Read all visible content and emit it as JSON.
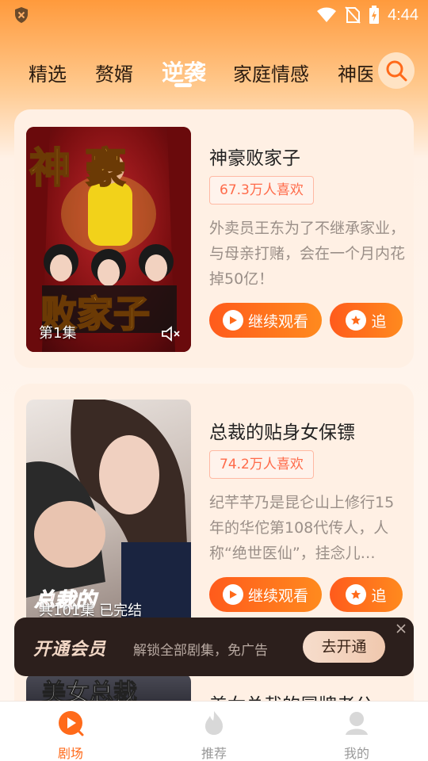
{
  "status_bar": {
    "time": "4:44"
  },
  "tabs": {
    "items": [
      {
        "label": "精选"
      },
      {
        "label": "赘婿"
      },
      {
        "label": "逆袭"
      },
      {
        "label": "家庭情感"
      },
      {
        "label": "神医"
      }
    ],
    "active": "逆袭"
  },
  "cards": [
    {
      "title": "神豪败家子",
      "likes": "67.3万人喜欢",
      "description": "外卖员王东为了不继承家业，与母亲打赌，会在一个月内花掉50亿！",
      "poster_caption": "第1集",
      "poster_text_top": "神 豪",
      "poster_text_bottom": "败家子",
      "watch_label": "继续观看",
      "follow_label": "追"
    },
    {
      "title": "总裁的贴身女保镖",
      "likes": "74.2万人喜欢",
      "description": "纪芊芊乃是昆仑山上修行15年的华佗第108代传人，人称“绝世医仙”，挂念儿…",
      "poster_caption": "共101集 已完结",
      "poster_text_bottom": "总裁的",
      "watch_label": "继续观看",
      "follow_label": "追"
    },
    {
      "title": "美女总裁的冒牌老公",
      "poster_text": "美女总裁"
    }
  ],
  "vip_banner": {
    "title": "开通会员",
    "subtitle": "解锁全部剧集，免广告",
    "button": "去开通"
  },
  "bottom_nav": [
    {
      "label": "剧场",
      "icon": "play-circle-icon",
      "active": true
    },
    {
      "label": "推荐",
      "icon": "flame-icon",
      "active": false
    },
    {
      "label": "我的",
      "icon": "user-icon",
      "active": false
    }
  ],
  "colors": {
    "accent": "#ff6a1a",
    "button_gradient_start": "#ff5b1c",
    "button_gradient_end": "#ff8a1e",
    "likes_text": "#ff6b4a",
    "vip_background": "#2c1f1c"
  }
}
